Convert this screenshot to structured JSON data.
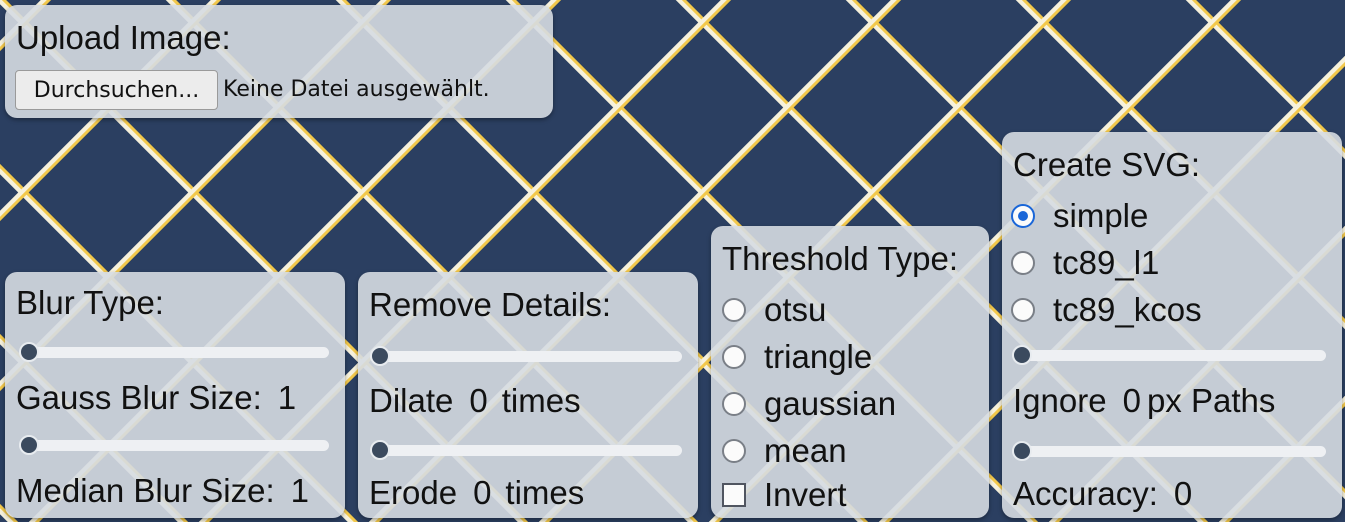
{
  "colors": {
    "background": "#2b3f61",
    "grid_line_gold": "#f2c84b",
    "grid_line_light": "#f6f1dc",
    "radio_selected": "#1a66d8"
  },
  "upload": {
    "title": "Upload Image:",
    "browse_button": "Durchsuchen...",
    "file_status": "Keine Datei ausgewählt."
  },
  "blur": {
    "title": "Blur Type:",
    "gauss_label": "Gauss Blur Size:",
    "gauss_value": "1",
    "gauss_slider": 0,
    "median_label": "Median Blur Size:",
    "median_value": "1",
    "median_slider": 0
  },
  "details": {
    "title": "Remove Details:",
    "dilate_label": "Dilate",
    "dilate_value": "0",
    "dilate_unit": "times",
    "dilate_slider": 0,
    "erode_label": "Erode",
    "erode_value": "0",
    "erode_unit": "times",
    "erode_slider": 0
  },
  "threshold": {
    "title": "Threshold Type:",
    "options": [
      "otsu",
      "triangle",
      "gaussian",
      "mean"
    ],
    "selected": null,
    "invert_label": "Invert",
    "invert_checked": false
  },
  "svg": {
    "title": "Create SVG:",
    "options": [
      "simple",
      "tc89_l1",
      "tc89_kcos"
    ],
    "selected": "simple",
    "ignore_label": "Ignore",
    "ignore_value": "0",
    "ignore_unit": "px Paths",
    "ignore_slider": 0,
    "accuracy_label": "Accuracy:",
    "accuracy_value": "0",
    "accuracy_slider": 0
  }
}
